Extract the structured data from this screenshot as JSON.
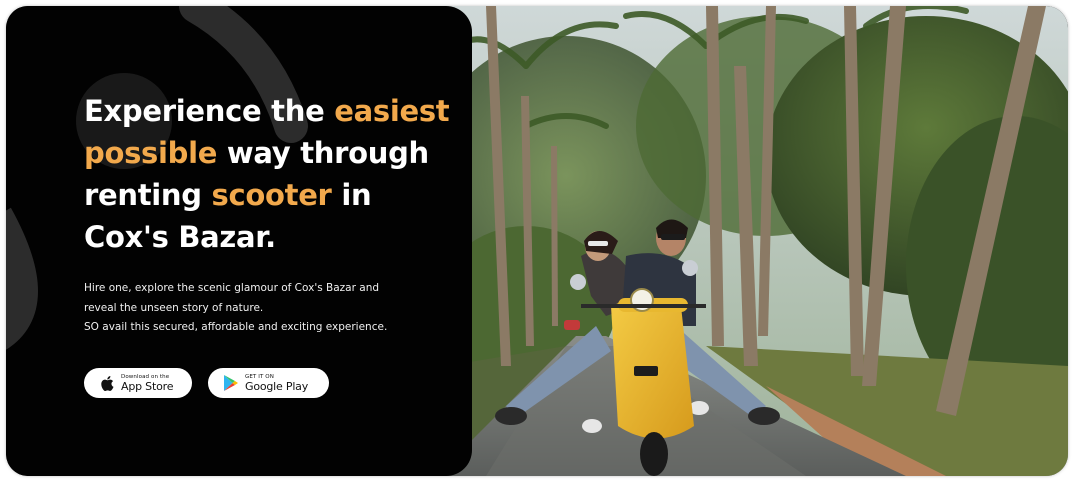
{
  "hero": {
    "headline": {
      "line1_a": "Experience the ",
      "line1_b": "easiest",
      "line2_a": "possible",
      "line2_b": " way through",
      "line3_a": "renting ",
      "line3_b": "scooter",
      "line3_c": " in",
      "line4": "Cox's Bazar."
    },
    "description": [
      "Hire one, explore the scenic glamour of Cox's Bazar and",
      "reveal the unseen story of nature.",
      "SO avail this secured, affordable and exciting experience."
    ],
    "colors": {
      "accent": "#f2a94c",
      "panel": "#020202",
      "text": "#ffffff"
    }
  },
  "store_buttons": {
    "app_store": {
      "small": "Download on the",
      "big": "App Store",
      "icon": "apple-icon"
    },
    "google_play": {
      "small": "GET IT ON",
      "big": "Google Play",
      "icon": "google-play-icon"
    }
  },
  "photo": {
    "subject": "two-people-riding-yellow-scooter-on-palm-lined-road"
  }
}
